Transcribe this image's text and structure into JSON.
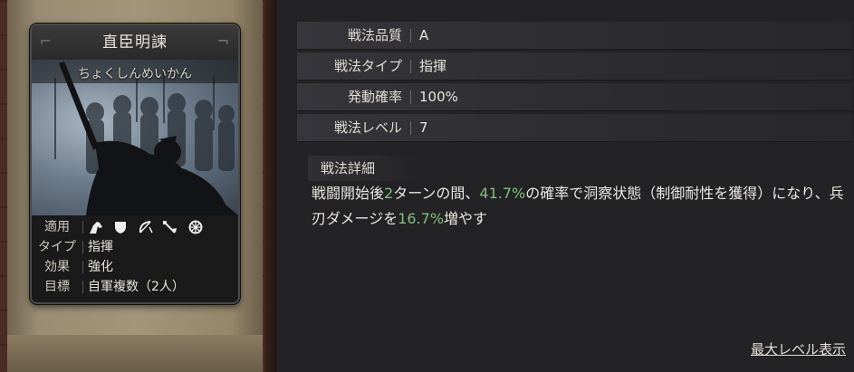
{
  "card": {
    "name": "直臣明諫",
    "reading": "ちょくしんめいかん",
    "info": {
      "apply_label": "適用",
      "type_label": "タイプ",
      "type_value": "指揮",
      "effect_label": "効果",
      "effect_value": "強化",
      "target_label": "目標",
      "target_value": "自軍複数（2人）"
    },
    "terrain_icons": [
      "cavalry-icon",
      "shield-icon",
      "bow-icon",
      "spear-icon",
      "chariot-wheel-icon"
    ]
  },
  "attributes": [
    {
      "label": "戦法品質",
      "value": "A"
    },
    {
      "label": "戦法タイプ",
      "value": "指揮"
    },
    {
      "label": "発動確率",
      "value": "100%"
    },
    {
      "label": "戦法レベル",
      "value": "7"
    }
  ],
  "detail": {
    "title": "戦法詳細",
    "text_parts": [
      "戦闘開始後",
      "2",
      "ターンの間、",
      "41.7%",
      "の確率で洞察状態（制御耐性を獲得）になり、兵刃ダメージを",
      "16.7%",
      "増やす"
    ],
    "highlight_color": "#7fbf7f"
  },
  "max_level_link": "最大レベル表示"
}
